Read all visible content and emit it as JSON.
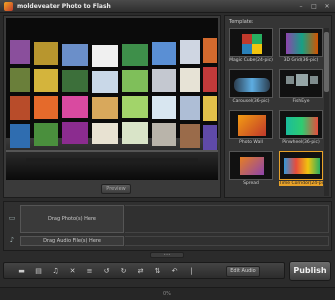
{
  "window": {
    "title": "moldeveater Photo to Flash",
    "minimize": "–",
    "maximize": "□",
    "close": "✕"
  },
  "preview": {
    "button_label": "Preview"
  },
  "templates": {
    "label": "Template:",
    "items": [
      {
        "label": "Magic Cube(24-pic)",
        "selected": false
      },
      {
        "label": "3D Grid(36-pic)",
        "selected": false
      },
      {
        "label": "Carousel(36-pic)",
        "selected": false
      },
      {
        "label": "FishEye",
        "selected": false
      },
      {
        "label": "Photo Wall",
        "selected": false
      },
      {
        "label": "Pinwheel(36-pic)",
        "selected": false
      },
      {
        "label": "Spread",
        "selected": false
      },
      {
        "label": "Time Corridor(24-pic)",
        "selected": true
      }
    ]
  },
  "timeline": {
    "photo_drop_label": "Drag Photo(s) Here",
    "audio_drop_label": "Drag Audio File(s) Here",
    "photo_track_icon": "photo-track-icon",
    "audio_track_icon": "audio-track-icon"
  },
  "toolbar": {
    "edit_audio_label": "Edit Audio",
    "icons": [
      "film-icon",
      "slideshow-icon",
      "music-icon",
      "delete-icon",
      "list-icon",
      "rotate-left-icon",
      "rotate-right-icon",
      "swap-icon",
      "flip-icon",
      "undo-icon",
      "separator-icon"
    ]
  },
  "publish_label": "Publish",
  "status": {
    "text": "0%"
  },
  "colors": {
    "accent": "#e8a229",
    "background": "#2b2b2b"
  }
}
